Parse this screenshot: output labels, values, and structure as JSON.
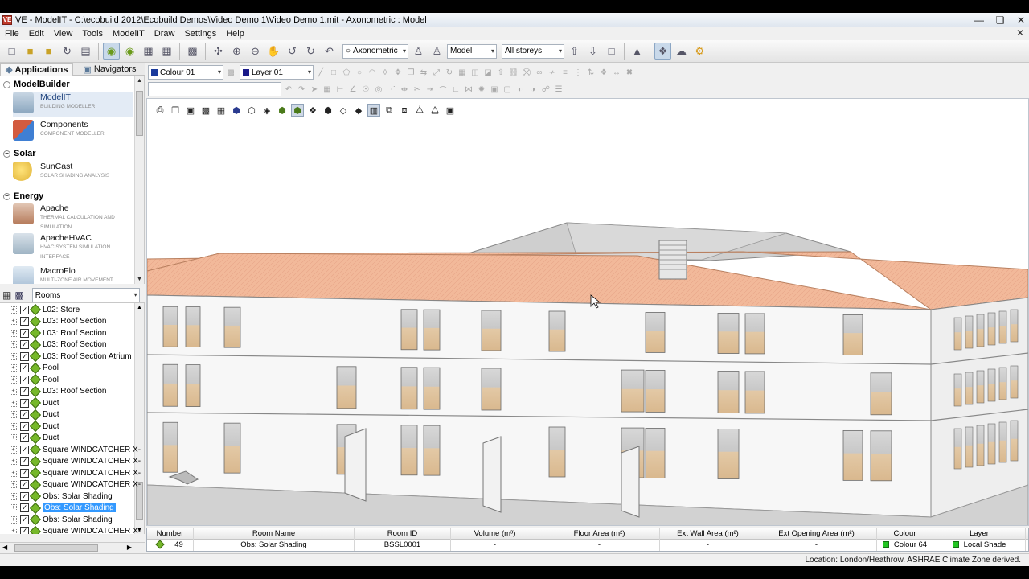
{
  "window": {
    "title": "VE - ModelIT - C:\\ecobuild 2012\\Ecobuild Demos\\Video Demo 1\\Video Demo 1.mit - Axonometric : Model",
    "app_icon_text": "VE"
  },
  "menu": [
    "File",
    "Edit",
    "View",
    "Tools",
    "ModelIT",
    "Draw",
    "Settings",
    "Help"
  ],
  "toolbar": {
    "view_mode": "Axonometric",
    "model_select": "Model",
    "storeys_select": "All storeys",
    "colour_select": "Colour 01",
    "layer_select": "Layer 01",
    "colour_swatch": "#1a3a9c",
    "layer_swatch": "#1a1a8a"
  },
  "left_panel": {
    "tabs": [
      "Applications",
      "Navigators"
    ],
    "groups": [
      {
        "name": "ModelBuilder",
        "apps": [
          {
            "name": "ModelIT",
            "sub": "BUILDING MODELLER",
            "color": "#8aa6bf"
          },
          {
            "name": "Components",
            "sub": "COMPONENT MODELLER",
            "color": "#d35b3f"
          }
        ]
      },
      {
        "name": "Solar",
        "apps": [
          {
            "name": "SunCast",
            "sub": "SOLAR SHADING ANALYSIS",
            "color": "#e9c14b"
          }
        ]
      },
      {
        "name": "Energy",
        "apps": [
          {
            "name": "Apache",
            "sub": "THERMAL CALCULATION AND SIMULATION",
            "color": "#c9a38a"
          },
          {
            "name": "ApacheHVAC",
            "sub": "HVAC SYSTEM SIMULATION INTERFACE",
            "color": "#9fb4c4"
          },
          {
            "name": "MacroFlo",
            "sub": "MULTI-ZONE AIR MOVEMENT",
            "color": "#a9c0d6"
          }
        ]
      }
    ],
    "rooms_filter": "Rooms",
    "rooms": [
      "L02: Store",
      "L03: Roof Section",
      "L03: Roof Section",
      "L03: Roof Section",
      "L03: Roof Section Atrium",
      "Pool",
      "Pool",
      "L03: Roof Section",
      "Duct",
      "Duct",
      "Duct",
      "Duct",
      "Square WINDCATCHER X-",
      "Square WINDCATCHER X-",
      "Square WINDCATCHER X-",
      "Square WINDCATCHER X-",
      "Obs: Solar Shading",
      "Obs: Solar Shading",
      "Obs: Solar Shading",
      "Square WINDCATCHER X-"
    ],
    "selected_room_index": 17
  },
  "table": {
    "headers": [
      "Number",
      "Room Name",
      "Room ID",
      "Volume (m³)",
      "Floor Area (m²)",
      "Ext Wall Area (m²)",
      "Ext Opening Area (m²)",
      "Colour",
      "Layer"
    ],
    "row": [
      "49",
      "Obs: Solar Shading",
      "BSSL0001",
      "-",
      "-",
      "-",
      "-",
      "Colour 64",
      "Local Shade"
    ]
  },
  "status": {
    "text": "Location: London/Heathrow. ASHRAE Climate Zone derived."
  }
}
